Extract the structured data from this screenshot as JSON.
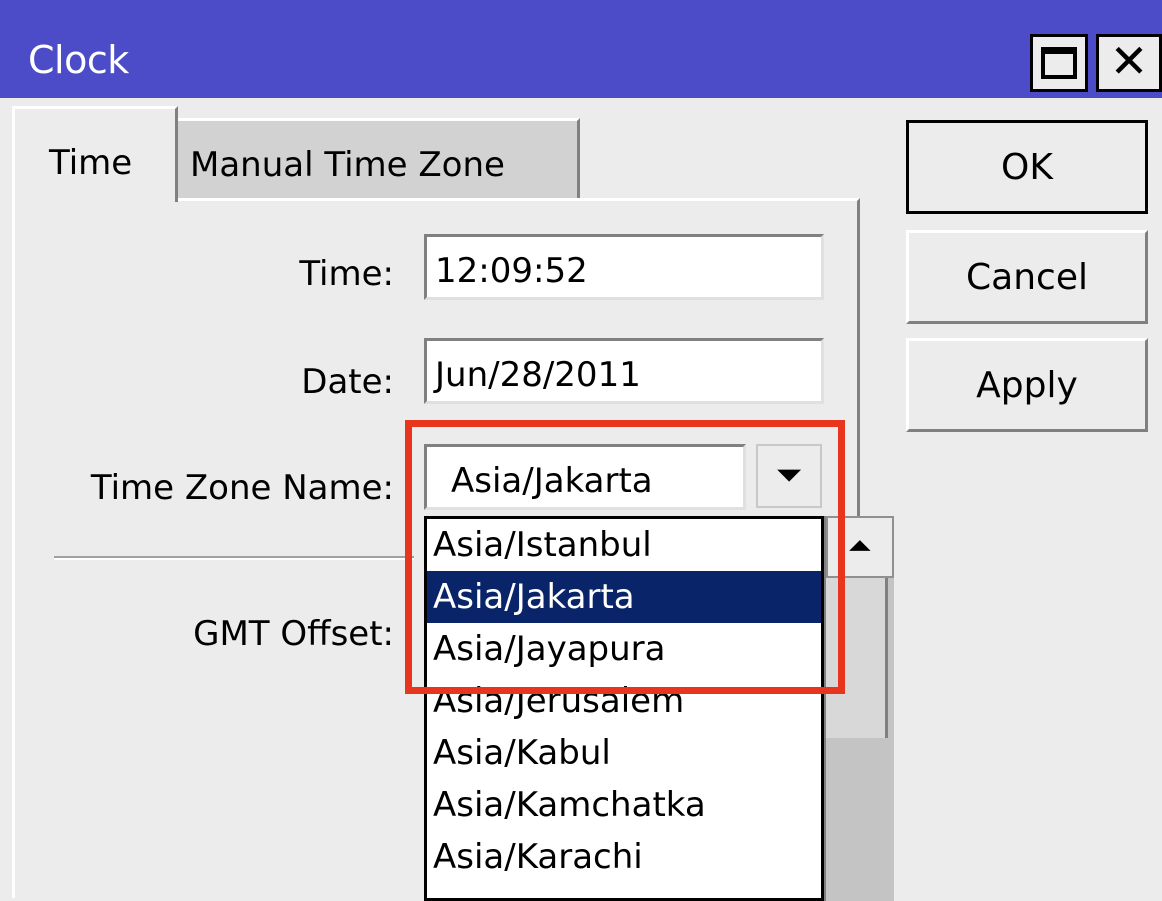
{
  "window": {
    "title": "Clock",
    "titlebar_color": "#4c4cc8",
    "maximize_icon": "maximize-icon",
    "close_icon": "close-icon",
    "close_glyph": "✕"
  },
  "tabs": [
    {
      "label": "Time",
      "active": true
    },
    {
      "label": "Manual Time Zone",
      "active": false
    }
  ],
  "form": {
    "time_label": "Time:",
    "time_value": "12:09:52",
    "date_label": "Date:",
    "date_value": "Jun/28/2011",
    "tz_label": "Time Zone Name:",
    "tz_value": "Asia/Jakarta",
    "gmt_label": "GMT Offset:"
  },
  "dropdown": {
    "options": [
      "Asia/Istanbul",
      "Asia/Jakarta",
      "Asia/Jayapura",
      "Asia/Jerusalem",
      "Asia/Kabul",
      "Asia/Kamchatka",
      "Asia/Karachi"
    ],
    "selected": "Asia/Jakarta",
    "selected_color": "#0a246a",
    "highlight_color": "#e8361e"
  },
  "buttons": {
    "ok": "OK",
    "cancel": "Cancel",
    "apply": "Apply"
  }
}
